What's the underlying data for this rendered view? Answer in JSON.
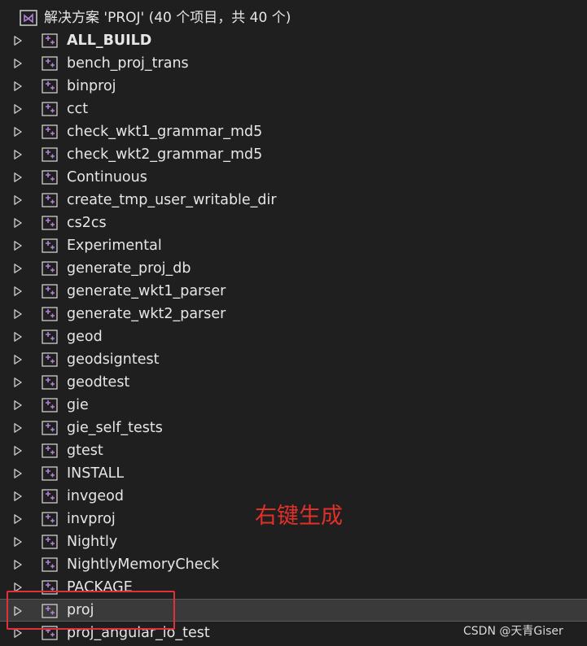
{
  "solution": {
    "label": "解决方案 'PROJ' (40 个项目，共 40 个)",
    "icon": "visual-studio-solution-icon"
  },
  "projects": [
    {
      "label": "ALL_BUILD",
      "bold": true
    },
    {
      "label": "bench_proj_trans"
    },
    {
      "label": "binproj"
    },
    {
      "label": "cct"
    },
    {
      "label": "check_wkt1_grammar_md5"
    },
    {
      "label": "check_wkt2_grammar_md5"
    },
    {
      "label": "Continuous"
    },
    {
      "label": "create_tmp_user_writable_dir"
    },
    {
      "label": "cs2cs"
    },
    {
      "label": "Experimental"
    },
    {
      "label": "generate_proj_db"
    },
    {
      "label": "generate_wkt1_parser"
    },
    {
      "label": "generate_wkt2_parser"
    },
    {
      "label": "geod"
    },
    {
      "label": "geodsigntest"
    },
    {
      "label": "geodtest"
    },
    {
      "label": "gie"
    },
    {
      "label": "gie_self_tests"
    },
    {
      "label": "gtest"
    },
    {
      "label": "INSTALL"
    },
    {
      "label": "invgeod"
    },
    {
      "label": "invproj"
    },
    {
      "label": "Nightly"
    },
    {
      "label": "NightlyMemoryCheck"
    },
    {
      "label": "PACKAGE"
    },
    {
      "label": "proj",
      "selected": true
    },
    {
      "label": "proj_angular_io_test"
    }
  ],
  "annotation": {
    "text": "右键生成",
    "color": "#e0302a"
  },
  "watermark": {
    "text": "CSDN @天青Giser"
  },
  "colors": {
    "background": "#1f1f1f",
    "text": "#e6e6e6",
    "selected_row": "#3a3a3a",
    "project_icon": "#b180d7",
    "highlight": "#e0303a"
  },
  "icons": {
    "expand": "chevron-right-outline-icon",
    "project": "cpp-project-icon"
  }
}
